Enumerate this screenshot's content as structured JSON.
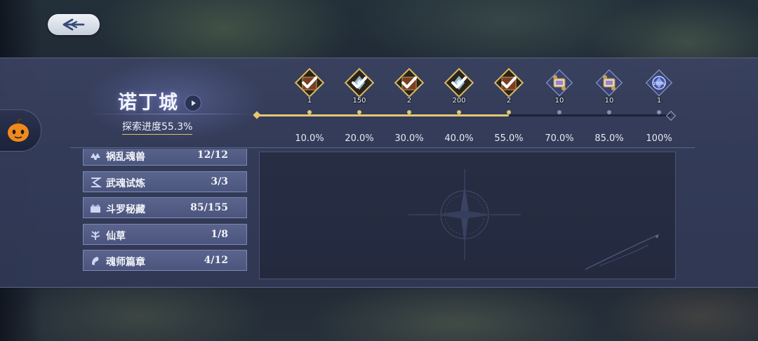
{
  "city": {
    "name": "诺丁城",
    "exploration_label": "探索进度55.3%",
    "exploration_progress": 55.3
  },
  "milestones": [
    {
      "percent": "10.0%",
      "reward_icon": "chest-icon",
      "count": "1",
      "claimed": true
    },
    {
      "percent": "20.0%",
      "reward_icon": "soul-ring-icon",
      "count": "150",
      "claimed": true
    },
    {
      "percent": "30.0%",
      "reward_icon": "chest-icon",
      "count": "2",
      "claimed": true
    },
    {
      "percent": "40.0%",
      "reward_icon": "soul-ring-icon",
      "count": "200",
      "claimed": true
    },
    {
      "percent": "55.0%",
      "reward_icon": "chest-icon",
      "count": "2",
      "claimed": true
    },
    {
      "percent": "70.0%",
      "reward_icon": "scroll-icon",
      "count": "10",
      "claimed": false
    },
    {
      "percent": "85.0%",
      "reward_icon": "scroll-icon",
      "count": "10",
      "claimed": false
    },
    {
      "percent": "100%",
      "reward_icon": "badge-icon",
      "count": "1",
      "claimed": false
    }
  ],
  "categories": [
    {
      "name": "祸乱魂兽",
      "count": "12/12",
      "icon": "beast-icon"
    },
    {
      "name": "武魂试炼",
      "count": "3/3",
      "icon": "trial-icon"
    },
    {
      "name": "斗罗秘藏",
      "count": "85/155",
      "icon": "treasure-icon"
    },
    {
      "name": "仙草",
      "count": "1/8",
      "icon": "herb-icon"
    },
    {
      "name": "魂师篇章",
      "count": "4/12",
      "icon": "chapter-icon"
    }
  ],
  "colors": {
    "gold": "#e3c872",
    "panel": "#3a4260",
    "claimed_check": "#ffffff"
  }
}
